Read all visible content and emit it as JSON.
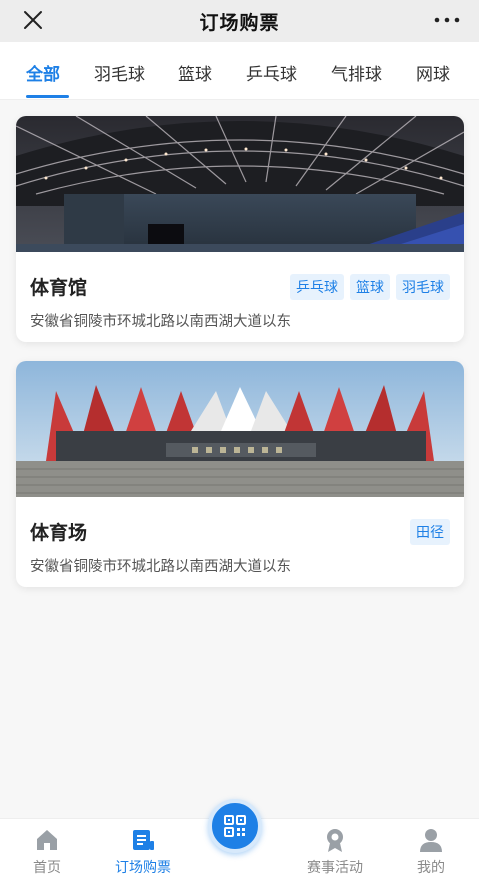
{
  "header": {
    "title": "订场购票"
  },
  "tabs": [
    {
      "label": "全部",
      "active": true
    },
    {
      "label": "羽毛球"
    },
    {
      "label": "篮球"
    },
    {
      "label": "乒乓球"
    },
    {
      "label": "气排球"
    },
    {
      "label": "网球"
    }
  ],
  "venues": [
    {
      "name": "体育馆",
      "tags": [
        "乒乓球",
        "篮球",
        "羽毛球"
      ],
      "address": "安徽省铜陵市环城北路以南西湖大道以东",
      "image": "indoor-arena-roof-photo"
    },
    {
      "name": "体育场",
      "tags": [
        "田径"
      ],
      "address": "安徽省铜陵市环城北路以南西湖大道以东",
      "image": "stadium-red-roof-photo"
    }
  ],
  "bottom_nav": [
    {
      "label": "首页",
      "icon": "home-icon"
    },
    {
      "label": "订场购票",
      "icon": "ticket-icon",
      "active": true
    },
    {
      "label": "赛事活动",
      "icon": "medal-icon"
    },
    {
      "label": "我的",
      "icon": "user-icon"
    }
  ],
  "center_button": {
    "icon": "qr-code-icon"
  },
  "colors": {
    "accent": "#1e80e6",
    "tag_bg": "#e7f2fd",
    "title_bar": "#ededed"
  }
}
